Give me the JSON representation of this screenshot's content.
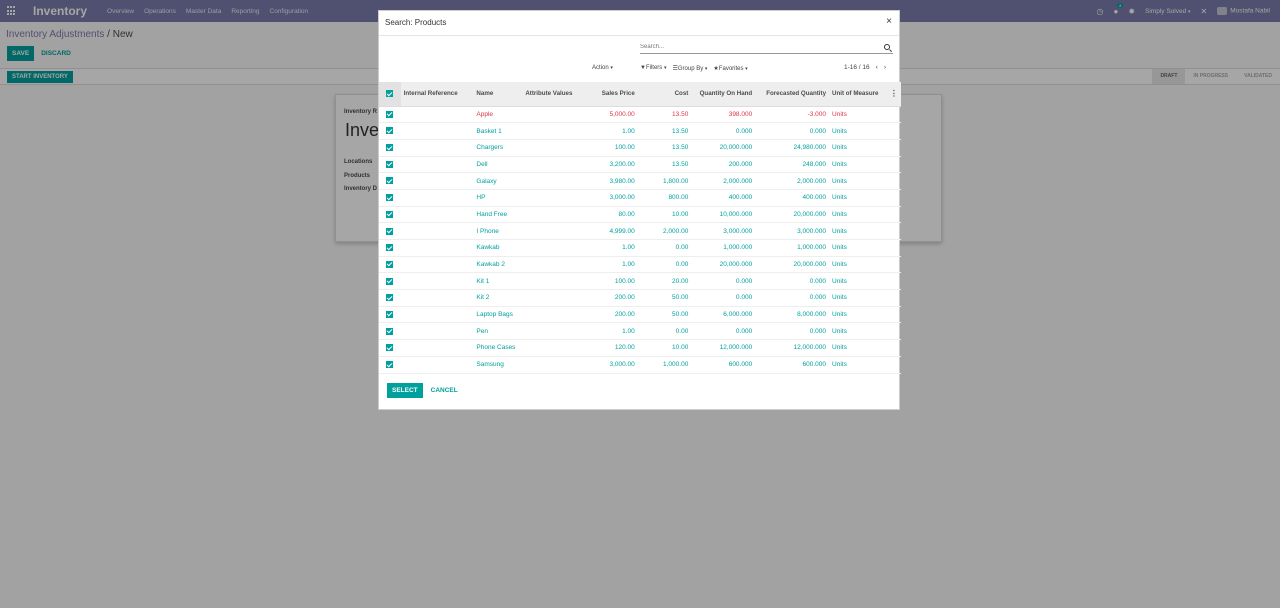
{
  "app": {
    "title": "Inventory",
    "menu": [
      "Overview",
      "Operations",
      "Master Data",
      "Reporting",
      "Configuration"
    ],
    "company": "Simply Solved",
    "user": "Mostafa Nabil",
    "chat_count": "2"
  },
  "breadcrumb": {
    "parent": "Inventory Adjustments",
    "separator": "/",
    "current": "New"
  },
  "buttons": {
    "save": "SAVE",
    "discard": "DISCARD",
    "start_inventory": "START INVENTORY"
  },
  "stages": [
    "DRAFT",
    "IN PROGRESS",
    "VALIDATED"
  ],
  "form": {
    "reference_label": "Inventory R",
    "name_value": "Inver",
    "locations_label": "Locations",
    "products_label": "Products",
    "inventory_date_label": "Inventory D"
  },
  "modal": {
    "title": "Search: Products",
    "close": "×",
    "search_placeholder": "Search...",
    "action_label": "Action",
    "filters_label": "Filters",
    "group_by_label": "Group By",
    "favorites_label": "Favorites",
    "pager": "1-16 / 16",
    "columns": [
      "Internal Reference",
      "Name",
      "Attribute Values",
      "Sales Price",
      "Cost",
      "Quantity On Hand",
      "Forecasted Quantity",
      "Unit of Measure"
    ],
    "rows": [
      {
        "ref": "",
        "name": "Apple",
        "attr": "",
        "price": "5,000.00",
        "cost": "13.50",
        "onhand": "398.000",
        "forecast": "-3.000",
        "uom": "Units",
        "danger": true
      },
      {
        "ref": "",
        "name": "Basket 1",
        "attr": "",
        "price": "1.00",
        "cost": "13.50",
        "onhand": "0.000",
        "forecast": "0.000",
        "uom": "Units",
        "danger": false
      },
      {
        "ref": "",
        "name": "Chargers",
        "attr": "",
        "price": "100.00",
        "cost": "13.50",
        "onhand": "20,000.000",
        "forecast": "24,980.000",
        "uom": "Units",
        "danger": false
      },
      {
        "ref": "",
        "name": "Dell",
        "attr": "",
        "price": "3,200.00",
        "cost": "13.50",
        "onhand": "200.000",
        "forecast": "248.000",
        "uom": "Units",
        "danger": false
      },
      {
        "ref": "",
        "name": "Galaxy",
        "attr": "",
        "price": "3,980.00",
        "cost": "1,800.00",
        "onhand": "2,000.000",
        "forecast": "2,000.000",
        "uom": "Units",
        "danger": false
      },
      {
        "ref": "",
        "name": "HP",
        "attr": "",
        "price": "3,000.00",
        "cost": "800.00",
        "onhand": "400.000",
        "forecast": "400.000",
        "uom": "Units",
        "danger": false
      },
      {
        "ref": "",
        "name": "Hand Free",
        "attr": "",
        "price": "80.00",
        "cost": "10.00",
        "onhand": "10,000.000",
        "forecast": "20,000.000",
        "uom": "Units",
        "danger": false
      },
      {
        "ref": "",
        "name": "I Phone",
        "attr": "",
        "price": "4,999.00",
        "cost": "2,000.00",
        "onhand": "3,000.000",
        "forecast": "3,000.000",
        "uom": "Units",
        "danger": false
      },
      {
        "ref": "",
        "name": "Kawkab",
        "attr": "",
        "price": "1.00",
        "cost": "0.00",
        "onhand": "1,000.000",
        "forecast": "1,000.000",
        "uom": "Units",
        "danger": false
      },
      {
        "ref": "",
        "name": "Kawkab 2",
        "attr": "",
        "price": "1.00",
        "cost": "0.00",
        "onhand": "20,000.000",
        "forecast": "20,000.000",
        "uom": "Units",
        "danger": false
      },
      {
        "ref": "",
        "name": "Kit 1",
        "attr": "",
        "price": "100.00",
        "cost": "20.00",
        "onhand": "0.000",
        "forecast": "0.000",
        "uom": "Units",
        "danger": false
      },
      {
        "ref": "",
        "name": "Kit 2",
        "attr": "",
        "price": "200.00",
        "cost": "50.00",
        "onhand": "0.000",
        "forecast": "0.000",
        "uom": "Units",
        "danger": false
      },
      {
        "ref": "",
        "name": "Laptop Bags",
        "attr": "",
        "price": "200.00",
        "cost": "50.00",
        "onhand": "6,000.000",
        "forecast": "8,000.000",
        "uom": "Units",
        "danger": false
      },
      {
        "ref": "",
        "name": "Pen",
        "attr": "",
        "price": "1.00",
        "cost": "0.00",
        "onhand": "0.000",
        "forecast": "0.000",
        "uom": "Units",
        "danger": false
      },
      {
        "ref": "",
        "name": "Phone Cases",
        "attr": "",
        "price": "120.00",
        "cost": "10.00",
        "onhand": "12,000.000",
        "forecast": "12,000.000",
        "uom": "Units",
        "danger": false
      },
      {
        "ref": "",
        "name": "Samsung",
        "attr": "",
        "price": "3,000.00",
        "cost": "1,000.00",
        "onhand": "600.000",
        "forecast": "600.000",
        "uom": "Units",
        "danger": false
      }
    ],
    "select_label": "SELECT",
    "cancel_label": "CANCEL"
  },
  "colors": {
    "navbar": "#7c7bad",
    "primary": "#00a09d",
    "danger": "#dc3545"
  }
}
